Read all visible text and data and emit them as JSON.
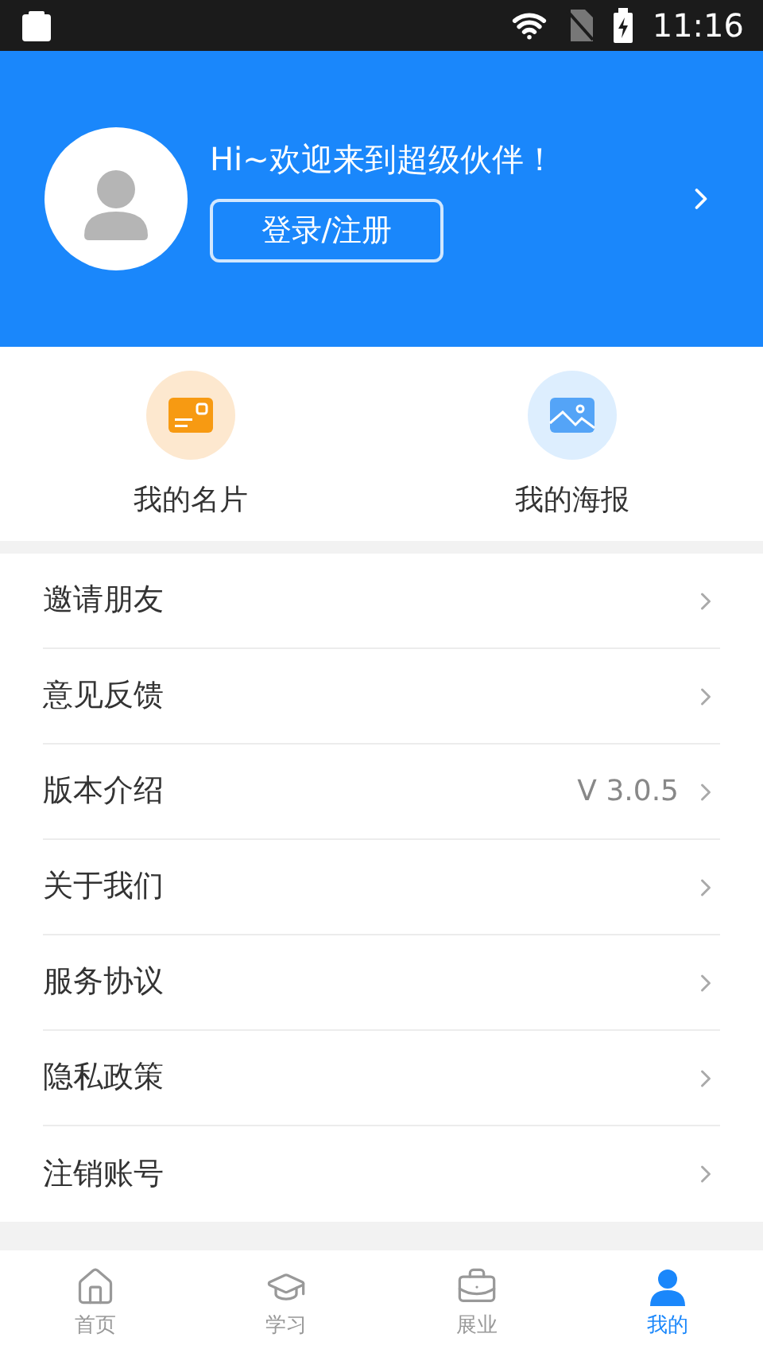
{
  "status_bar": {
    "time": "11:16"
  },
  "profile": {
    "greeting": "Hi~欢迎来到超级伙伴！",
    "login_button": "登录/注册"
  },
  "shortcuts": [
    {
      "kind": "card",
      "label": "我的名片"
    },
    {
      "kind": "poster",
      "label": "我的海报"
    }
  ],
  "menu": [
    {
      "label": "邀请朋友"
    },
    {
      "label": "意见反馈"
    },
    {
      "label": "版本介绍",
      "value": "V 3.0.5"
    },
    {
      "label": "关于我们"
    },
    {
      "label": "服务协议"
    },
    {
      "label": "隐私政策"
    },
    {
      "label": "注销账号"
    }
  ],
  "tab_bar": [
    {
      "kind": "home",
      "label": "首页",
      "selected": false
    },
    {
      "kind": "study",
      "label": "学习",
      "selected": false
    },
    {
      "kind": "work",
      "label": "展业",
      "selected": false
    },
    {
      "kind": "me",
      "label": "我的",
      "selected": true
    }
  ]
}
